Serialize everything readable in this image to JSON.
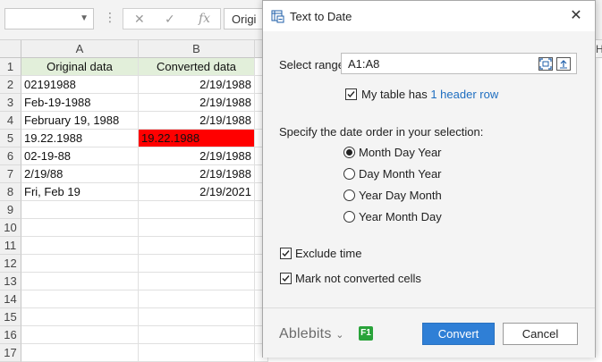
{
  "excel": {
    "formula_bar_text": "Origi",
    "fx_label": "fx",
    "columns": [
      "A",
      "B"
    ],
    "rows": [
      "1",
      "2",
      "3",
      "4",
      "5",
      "6",
      "7",
      "8",
      "9",
      "10",
      "11",
      "12",
      "13",
      "14",
      "15",
      "16",
      "17"
    ],
    "cells": [
      [
        "Original data",
        "Converted data"
      ],
      [
        "02191988",
        "2/19/1988"
      ],
      [
        "Feb-19-1988",
        "2/19/1988"
      ],
      [
        "February 19, 1988",
        "2/19/1988"
      ],
      [
        "19.22.1988",
        "19.22.1988"
      ],
      [
        "02-19-88",
        "2/19/1988"
      ],
      [
        "2/19/88",
        "2/19/1988"
      ],
      [
        "Fri, Feb 19",
        "2/19/2021"
      ]
    ],
    "next_column_letter": "H",
    "colors": {
      "header_fill": "#e2efda",
      "error_fill": "#ff0000"
    }
  },
  "dialog": {
    "title": "Text to Date",
    "select_range_label": "Select range:",
    "range_value": "A1:A8",
    "header_checkbox_label": "My table has",
    "header_link": "1 header row",
    "date_order_label": "Specify the date order in your selection:",
    "date_orders": [
      "Month Day Year",
      "Day Month Year",
      "Year Day Month",
      "Year Month Day"
    ],
    "selected_order": "Month Day Year",
    "exclude_time_label": "Exclude time",
    "mark_not_converted_label": "Mark not converted cells",
    "brand": "Ablebits",
    "help_badge": "F1",
    "convert_label": "Convert",
    "cancel_label": "Cancel",
    "colors": {
      "primary": "#2f7fd6",
      "link": "#1e6ec0"
    }
  }
}
